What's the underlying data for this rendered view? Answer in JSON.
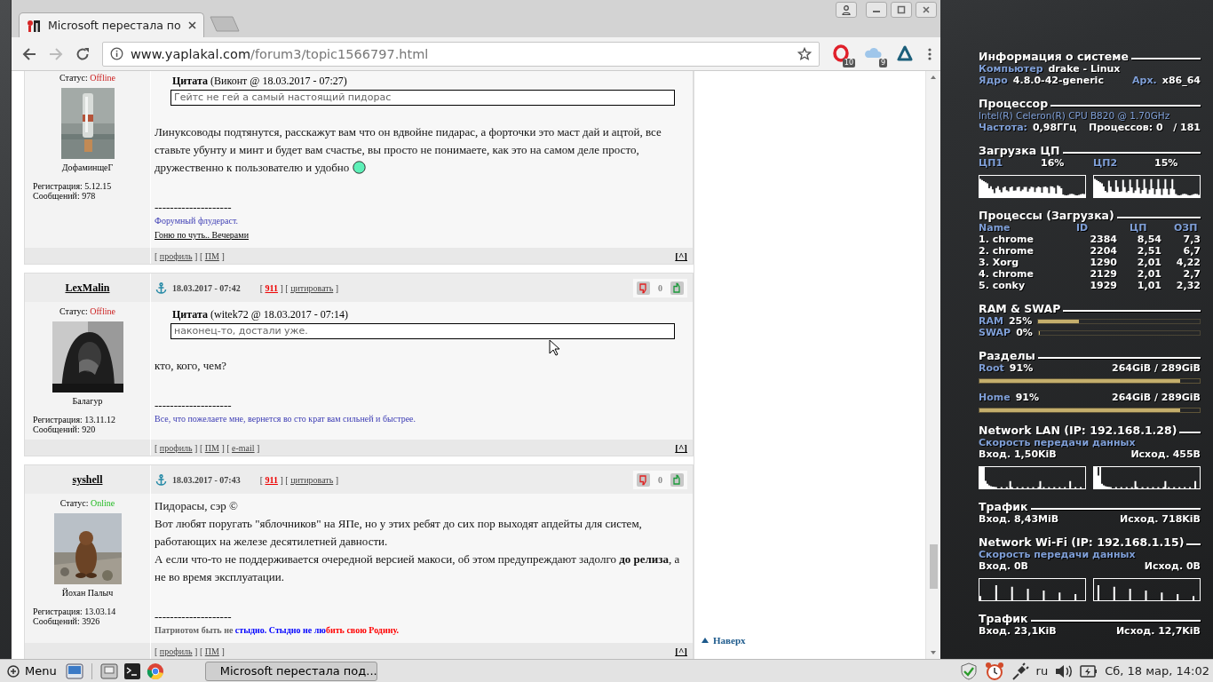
{
  "browser": {
    "tab": {
      "title": "Microsoft перестала по",
      "selected": true
    },
    "nav": {
      "back_enabled": true,
      "forward_enabled": false
    },
    "address": {
      "host": "www.yaplakal.com",
      "path": "/forum3/topic1566797.html"
    },
    "extensions": [
      {
        "kind": "opera",
        "badge": "10"
      },
      {
        "kind": "cloud",
        "badge": "9"
      },
      {
        "kind": "triangle"
      }
    ]
  },
  "posts": [
    {
      "status": {
        "label": "Статус:",
        "value": "Offline",
        "online": false
      },
      "rank": "ДофаминщеГ",
      "registration": "Регистрация: 5.12.15",
      "messages": "Сообщений: 978",
      "quote": {
        "label": "Цитата",
        "meta": "(Виконт @ 18.03.2017 - 07:27)",
        "text": "Гейтс не гей а самый настоящий пидорас"
      },
      "paragraphs": [
        "Линуксоводы подтянутся, расскажут вам что он вдвойне пидарас, а форточки это маст дай и ацтой, все ставьте убунту и минт и будет вам счастье, вы просто не понимаете, как это на самом деле просто, дружественно к пользователю и удобно"
      ],
      "smiley": true,
      "separator": "--------------------",
      "signature": [
        {
          "segments": [
            {
              "text": "Форумный флудераст.",
              "kind": "plain"
            }
          ]
        },
        {
          "segments": [
            {
              "text": "Гоню по чуть.. Вечерами",
              "kind": "link"
            }
          ]
        }
      ],
      "footer": [
        {
          "text": "[ ",
          "kind": "plain"
        },
        {
          "text": "профиль",
          "kind": "link"
        },
        {
          "text": " ] [ ",
          "kind": "plain"
        },
        {
          "text": "ПМ",
          "kind": "link"
        },
        {
          "text": " ]",
          "kind": "plain"
        }
      ],
      "top_link": "[^]"
    },
    {
      "author": "LexMalin",
      "date": "18.03.2017 - 07:42",
      "header_links": [
        {
          "text": "[ ",
          "kind": "plain"
        },
        {
          "text": "911",
          "kind": "hot"
        },
        {
          "text": " ] [ ",
          "kind": "plain"
        },
        {
          "text": "цитировать",
          "kind": "link"
        },
        {
          "text": " ]",
          "kind": "plain"
        }
      ],
      "votes": "0",
      "status": {
        "label": "Статус:",
        "value": "Offline",
        "online": false
      },
      "rank": "Балагур",
      "registration": "Регистрация: 13.11.12",
      "messages": "Сообщений: 920",
      "quote": {
        "label": "Цитата",
        "meta": "(witek72 @ 18.03.2017 - 07:14)",
        "text": "наконец-то, достали уже."
      },
      "paragraphs": [
        "кто, кого, чем?"
      ],
      "smiley": false,
      "separator": "--------------------",
      "signature": [
        {
          "segments": [
            {
              "text": "Все, что пожелаете мне, вернется во сто крат вам сильней и быстрее.",
              "kind": "plain"
            }
          ]
        }
      ],
      "footer": [
        {
          "text": "[ ",
          "kind": "plain"
        },
        {
          "text": "профиль",
          "kind": "link"
        },
        {
          "text": " ] [ ",
          "kind": "plain"
        },
        {
          "text": "ПМ",
          "kind": "link"
        },
        {
          "text": " ] [ ",
          "kind": "plain"
        },
        {
          "text": "e-mail",
          "kind": "link"
        },
        {
          "text": " ]",
          "kind": "plain"
        }
      ],
      "top_link": "[^]"
    },
    {
      "author": "syshell",
      "date": "18.03.2017 - 07:43",
      "header_links": [
        {
          "text": "[ ",
          "kind": "plain"
        },
        {
          "text": "911",
          "kind": "hot"
        },
        {
          "text": " ] [ ",
          "kind": "plain"
        },
        {
          "text": "цитировать",
          "kind": "link"
        },
        {
          "text": " ]",
          "kind": "plain"
        }
      ],
      "votes": "0",
      "status": {
        "label": "Статус:",
        "value": "Online",
        "online": true
      },
      "rank": "Йохан Палыч",
      "registration": "Регистрация: 13.03.14",
      "messages": "Сообщений: 3926",
      "paragraphs": [
        "Пидорасы, сэр ©",
        "Вот любят поругать \"яблочников\" на ЯПе, но у этих ребят до сих пор выходят апдейты для систем, работающих на железе десятилетней давности.",
        "А если что-то не поддерживается очередной версией макоси, об этом предупреждают задолго **до релиза**, а не во время эксплуатации."
      ],
      "smiley": false,
      "separator": "--------------------",
      "signature": [
        {
          "segments": [
            {
              "text": "Патриотом быть не ",
              "kind": "bold",
              "color": "#666666"
            },
            {
              "text": "стыдно. Стыдно не лю",
              "kind": "bold",
              "color": "#0000ff"
            },
            {
              "text": "бить свою Родину.",
              "kind": "bold",
              "color": "#ff0000"
            }
          ]
        }
      ],
      "footer": [
        {
          "text": "[ ",
          "kind": "plain"
        },
        {
          "text": "профиль",
          "kind": "link"
        },
        {
          "text": " ] [ ",
          "kind": "plain"
        },
        {
          "text": "ПМ",
          "kind": "link"
        },
        {
          "text": " ]",
          "kind": "plain"
        }
      ],
      "top_link": "[^]"
    }
  ],
  "back_to_top": "Наверх",
  "conky": {
    "sections": [
      {
        "title": "Информация о системе",
        "rows": [
          {
            "kind": "pair",
            "left": [
              {
                "text": "Компьютер",
                "kind": "label"
              },
              {
                "text": "drake - Linux",
                "kind": "value"
              }
            ]
          },
          {
            "kind": "pair",
            "left": [
              {
                "text": "Ядро",
                "kind": "label"
              },
              {
                "text": "4.8.0-42-generic",
                "kind": "value"
              }
            ],
            "right": [
              {
                "text": "Арх.",
                "kind": "label"
              },
              {
                "text": "x86_64",
                "kind": "value"
              }
            ]
          }
        ]
      },
      {
        "title": "Процессор",
        "rows": [
          {
            "kind": "pair",
            "left": [
              {
                "text": "Intel(R) Celeron(R) CPU B820 @ 1.70GHz",
                "kind": "note"
              }
            ]
          },
          {
            "kind": "pair",
            "left": [
              {
                "text": "Частота:",
                "kind": "label"
              },
              {
                "text": "0,98ГГц",
                "kind": "value"
              }
            ],
            "right": [
              {
                "text": "Процессов: 0   / 181",
                "kind": "value"
              }
            ]
          }
        ]
      },
      {
        "title": "Загрузка ЦП",
        "rows": [
          {
            "kind": "grid4",
            "cells": [
              {
                "text": "ЦП1",
                "kind": "label"
              },
              {
                "text": "16%",
                "kind": "value"
              },
              {
                "text": "ЦП2",
                "kind": "label"
              },
              {
                "text": "15%",
                "kind": "value"
              }
            ]
          },
          {
            "kind": "graphs"
          }
        ]
      },
      {
        "title": "Процессы (Загрузка)",
        "rows": [
          {
            "kind": "table",
            "columns": [
              "Name",
              "ID",
              "ЦП",
              "ОЗП"
            ],
            "rows": [
              [
                "1. chrome",
                "2384",
                "8,54",
                "7,3"
              ],
              [
                "2. chrome",
                "2204",
                "2,51",
                "6,7"
              ],
              [
                "3. Xorg",
                "1290",
                "2,01",
                "4,22"
              ],
              [
                "4. chrome",
                "2129",
                "2,01",
                "2,7"
              ],
              [
                "5. conky",
                "1929",
                "1,01",
                "2,32"
              ]
            ]
          }
        ]
      },
      {
        "title": "RAM & SWAP",
        "rows": [
          {
            "kind": "inline_bar",
            "label": "RAM",
            "value": "25%",
            "level": 0.25
          },
          {
            "kind": "inline_bar",
            "label": "SWAP",
            "value": "0%",
            "level": 0
          }
        ]
      },
      {
        "title": "Разделы",
        "rows": [
          {
            "kind": "below_bar",
            "label": "Root",
            "value": "91%",
            "size": "264GiB / 289GiB",
            "level": 0.91
          },
          {
            "kind": "below_bar",
            "label": "Home",
            "value": "91%",
            "size": "264GiB / 289GiB",
            "level": 0.91
          }
        ]
      },
      {
        "title": "Network LAN (IP: 192.168.1.28)",
        "rows": [
          {
            "kind": "pair",
            "left": [
              {
                "text": "Скорость передачи данных",
                "kind": "label"
              }
            ]
          },
          {
            "kind": "pair",
            "left": [
              {
                "text": "Вход. 1,50KiB",
                "kind": "value"
              }
            ],
            "right": [
              {
                "text": "Исход. 455B",
                "kind": "value"
              }
            ]
          },
          {
            "kind": "graphs"
          }
        ]
      },
      {
        "title": "Трафик",
        "rows": [
          {
            "kind": "pair",
            "left": [
              {
                "text": "Вход. 8,43MiB",
                "kind": "value"
              }
            ],
            "right": [
              {
                "text": "Исход. 718KiB",
                "kind": "value"
              }
            ]
          }
        ]
      },
      {
        "title": "Network Wi-Fi (IP: 192.168.1.15)",
        "rows": [
          {
            "kind": "pair",
            "left": [
              {
                "text": "Скорость передачи данных",
                "kind": "label"
              }
            ]
          },
          {
            "kind": "pair",
            "left": [
              {
                "text": "Вход. 0B",
                "kind": "value"
              }
            ],
            "right": [
              {
                "text": "Исход. 0B",
                "kind": "value"
              }
            ]
          },
          {
            "kind": "graphs"
          }
        ]
      },
      {
        "title": "Трафик",
        "rows": [
          {
            "kind": "pair",
            "left": [
              {
                "text": "Вход. 23,1KiB",
                "kind": "value"
              }
            ],
            "right": [
              {
                "text": "Исход. 12,7KiB",
                "kind": "value"
              }
            ]
          }
        ]
      }
    ]
  },
  "taskbar": {
    "menu": "Menu",
    "window": "Microsoft перестала под...",
    "layout": "ru",
    "clock": "Сб, 18 мар, 14:02"
  }
}
